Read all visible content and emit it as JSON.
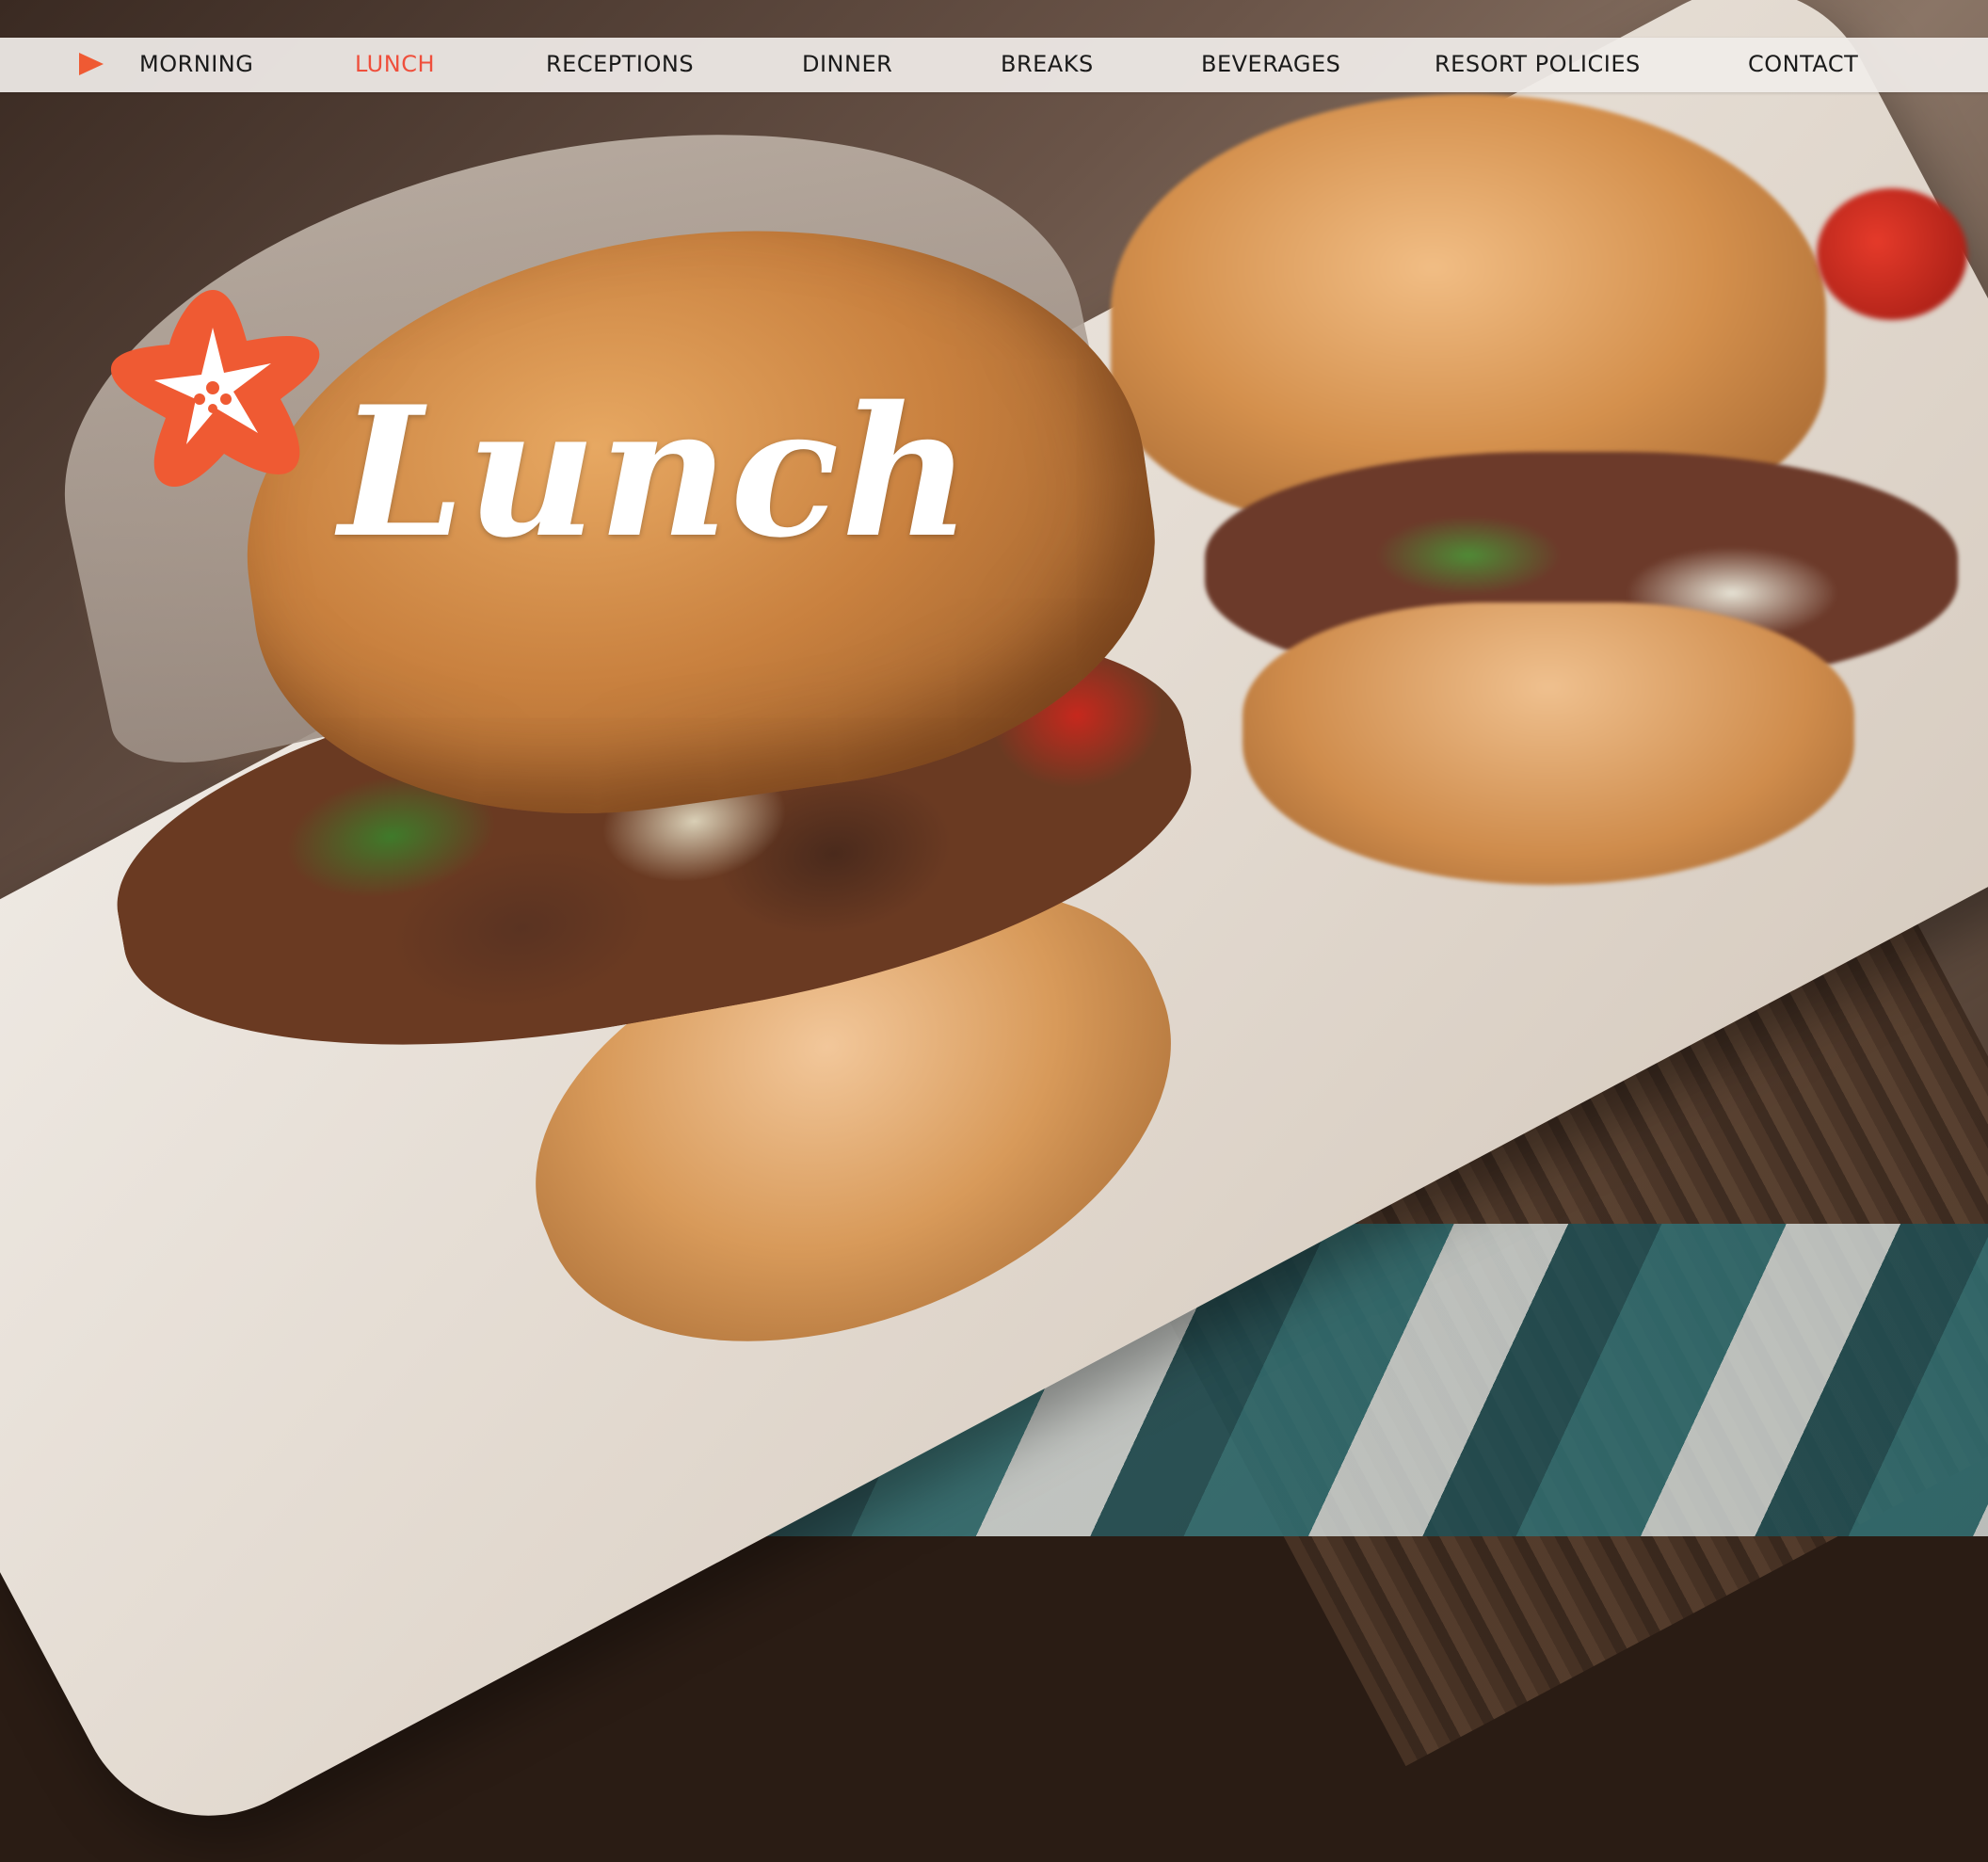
{
  "nav": {
    "items": [
      {
        "label": "MORNING",
        "active": false
      },
      {
        "label": "LUNCH",
        "active": true
      },
      {
        "label": "RECEPTIONS",
        "active": false
      },
      {
        "label": "DINNER",
        "active": false
      },
      {
        "label": "BREAKS",
        "active": false
      },
      {
        "label": "BEVERAGES",
        "active": false
      },
      {
        "label": "RESORT POLICIES",
        "active": false
      },
      {
        "label": "CONTACT",
        "active": false
      }
    ],
    "arrow_icon": "play-triangle-icon",
    "active_color": "#ef4f3c",
    "text_color": "#1a1a1a",
    "bar_color": "#f0ece8"
  },
  "hero": {
    "title": "Lunch",
    "logo_icon": "starfish-icon",
    "logo_color": "#ef5a33",
    "image_alt": "sandwiches on a white tray"
  }
}
